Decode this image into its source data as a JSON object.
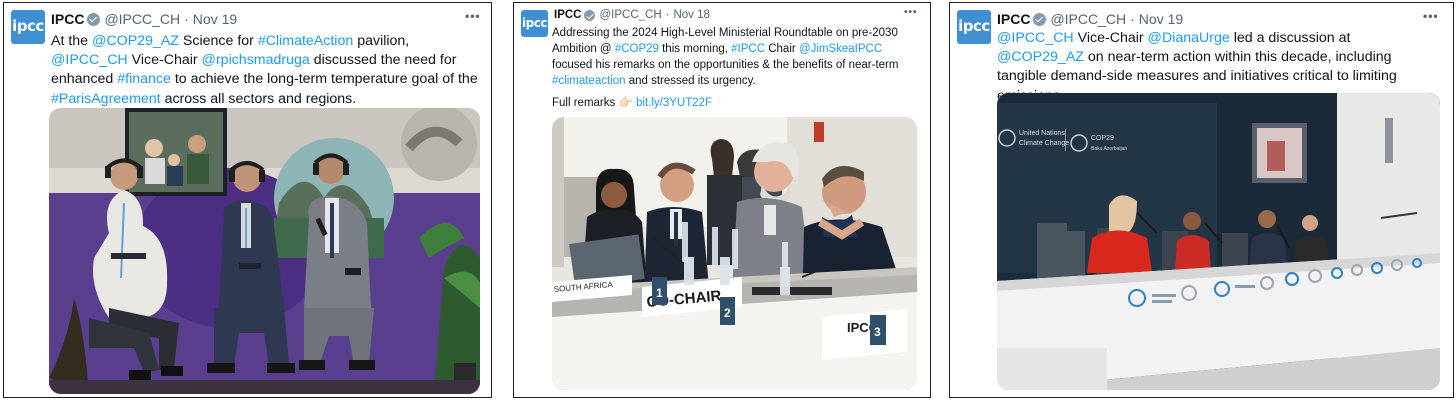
{
  "tweets": [
    {
      "account": {
        "name": "IPCC",
        "handle": "@IPCC_CH",
        "date": "Nov 19",
        "avatar_text": "ipcc",
        "avatar_sub": "",
        "menu": "•••"
      },
      "text": [
        {
          "t": "At the ",
          "link": false
        },
        {
          "t": "@COP29_AZ",
          "link": true
        },
        {
          "t": " Science for ",
          "link": false
        },
        {
          "t": "#ClimateAction",
          "link": true
        },
        {
          "t": " pavilion, ",
          "link": false
        },
        {
          "t": "@IPCC_CH",
          "link": true
        },
        {
          "t": " Vice-Chair ",
          "link": false
        },
        {
          "t": "@rpichsmadruga",
          "link": true
        },
        {
          "t": " discussed the need for enhanced ",
          "link": false
        },
        {
          "t": "#finance",
          "link": true
        },
        {
          "t": " to achieve the long-term temperature goal of the ",
          "link": false
        },
        {
          "t": "#ParisAgreement",
          "link": true
        },
        {
          "t": " across all sectors and regions.",
          "link": false
        }
      ]
    },
    {
      "account": {
        "name": "IPCC",
        "handle": "@IPCC_CH",
        "date": "Nov 18",
        "avatar_text": "ipcc",
        "avatar_sub": "",
        "menu": "•••"
      },
      "text": [
        {
          "t": "Addressing the 2024 High-Level Ministerial Roundtable on pre-2030 Ambition @ ",
          "link": false
        },
        {
          "t": "#COP29",
          "link": true
        },
        {
          "t": " this morning, ",
          "link": false
        },
        {
          "t": "#IPCC",
          "link": true
        },
        {
          "t": " Chair ",
          "link": false
        },
        {
          "t": "@JimSkeaIPCC",
          "link": true
        },
        {
          "t": " focused his remarks on the opportunities & the benefits of near-term ",
          "link": false
        },
        {
          "t": "#climateaction",
          "link": true
        },
        {
          "t": " and stressed its urgency.",
          "link": false
        }
      ],
      "remarks_label": "Full remarks",
      "remarks_emoji": "👉🏻",
      "remarks_link": "bit.ly/3YUT22F",
      "photo_labels": {
        "country": "SOUTH AFRICA",
        "chair": "CO-CHAIR",
        "ipcc": "IPCC",
        "n1": "1",
        "n2": "2",
        "n3": "3"
      }
    },
    {
      "account": {
        "name": "IPCC",
        "handle": "@IPCC_CH",
        "date": "Nov 19",
        "avatar_text": "ipcc",
        "avatar_sub": "",
        "menu": "•••"
      },
      "text": [
        {
          "t": "@IPCC_CH",
          "link": true
        },
        {
          "t": " Vice-Chair ",
          "link": false
        },
        {
          "t": "@DianaUrge",
          "link": true
        },
        {
          "t": " led a discussion at ",
          "link": false
        },
        {
          "t": "@COP29_AZ",
          "link": true
        },
        {
          "t": " on near-term action within this decade, including tangible demand-side measures and initiatives critical to limiting emissions.",
          "link": false
        }
      ],
      "photo_labels": {
        "un": "United Nations",
        "cc": "Climate Change",
        "cop": "COP29",
        "baku": "Baku Azerbaijan"
      }
    }
  ],
  "colors": {
    "link": "#1d9bf0",
    "text": "#0f1419",
    "muted": "#536471",
    "avatar": "#3f8fd2",
    "verified": "#829aab"
  }
}
